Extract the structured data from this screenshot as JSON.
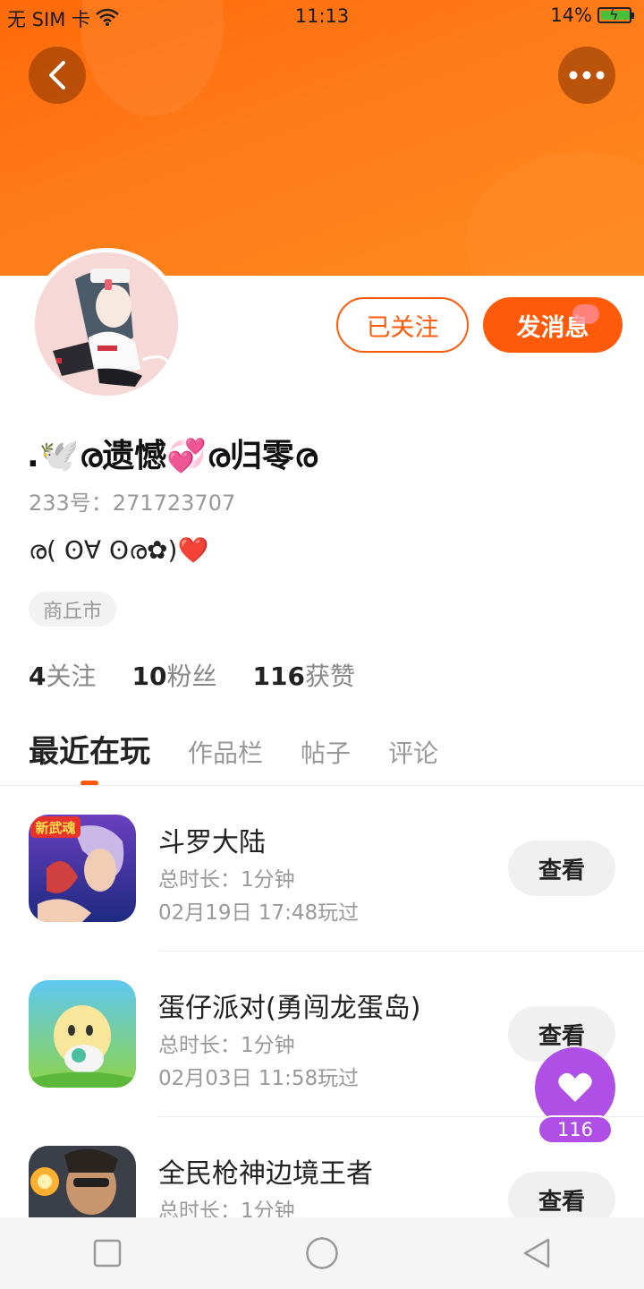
{
  "status_bar": {
    "carrier": "无 SIM 卡",
    "time": "11:13",
    "battery": "14%"
  },
  "header": {
    "back_icon": "chevron-left-icon",
    "more_icon": "more-dots-icon"
  },
  "profile": {
    "username": ".🕊️ര遗憾💞ര归零ര",
    "id_text": "233号：271723707",
    "bio": "ര( ʘ∀ ʘര✿)❤️",
    "location": "商丘市",
    "follow_label": "已关注",
    "message_label": "发消息"
  },
  "stats": {
    "following_count": "4",
    "following_label": "关注",
    "fans_count": "10",
    "fans_label": "粉丝",
    "likes_count": "116",
    "likes_label": "获赞"
  },
  "tabs": [
    "最近在玩",
    "作品栏",
    "帖子",
    "评论"
  ],
  "games": [
    {
      "name": "斗罗大陆",
      "duration": "总时长：1分钟",
      "last_played": "02月19日 17:48玩过",
      "badge": "新武魂",
      "button": "查看"
    },
    {
      "name": "蛋仔派对(勇闯龙蛋岛)",
      "duration": "总时长：1分钟",
      "last_played": "02月03日 11:58玩过",
      "button": "查看"
    },
    {
      "name": "全民枪神边境王者",
      "duration": "总时长：1分钟",
      "last_played": "",
      "button": "查看"
    }
  ],
  "like_fab": {
    "count": "116",
    "icon": "heart-icon"
  },
  "nav": {
    "icons": [
      "square-icon",
      "circle-icon",
      "triangle-back-icon"
    ]
  },
  "colors": {
    "accent": "#ff5a0a",
    "banner": "#ff7514",
    "fab": "#b04fe6"
  }
}
